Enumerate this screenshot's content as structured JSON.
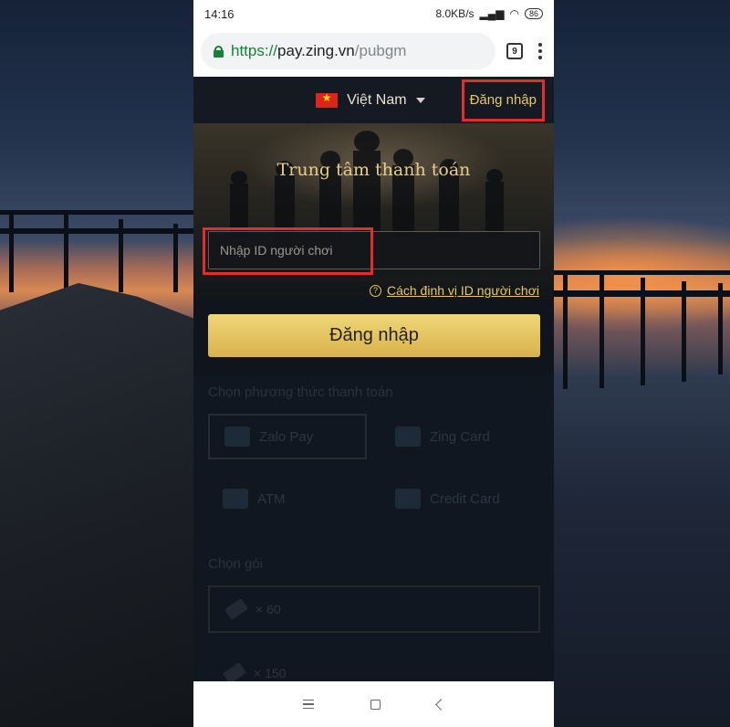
{
  "status_bar": {
    "time": "14:16",
    "network_speed": "8.0KB/s",
    "battery": "86"
  },
  "browser": {
    "url_scheme": "https://",
    "url_host": "pay.zing.vn",
    "url_path": "/pubgm",
    "tab_count": "9"
  },
  "site": {
    "language": "Việt Nam",
    "login_link": "Đăng nhập",
    "hero_title": "Trung tâm thanh toán",
    "id_input_placeholder": "Nhập ID người chơi",
    "help_link": "Cách định vị ID người chơi",
    "login_button": "Đăng nhập",
    "payment_section_title": "Chọn phương thức thanh toán",
    "payment_methods": [
      {
        "label": "Zalo Pay",
        "selected": true
      },
      {
        "label": "Zing Card",
        "selected": false
      },
      {
        "label": "ATM",
        "selected": false
      },
      {
        "label": "Credit Card",
        "selected": false
      }
    ],
    "package_section_title": "Chọn gói",
    "packages": [
      {
        "label": "× 60",
        "selected": true
      },
      {
        "label": "× 150",
        "selected": false
      }
    ]
  },
  "colors": {
    "accent_gold": "#e6c86a",
    "highlight_red": "#e52c2c",
    "button_gold": "#d9b24b"
  }
}
